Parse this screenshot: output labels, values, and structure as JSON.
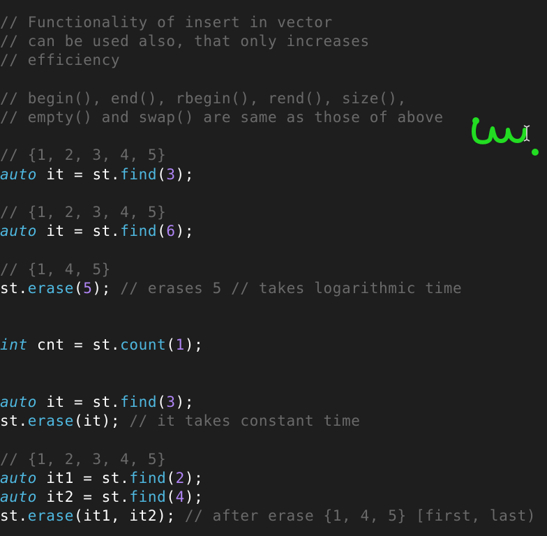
{
  "colors": {
    "background": "#1e1e1e",
    "comment": "#6a6a6a",
    "keyword": "#4fb8e0",
    "function": "#4fb8e0",
    "number": "#b085f5",
    "plain": "#ffffff",
    "annotation": "#22dd22"
  },
  "lines": [
    [
      {
        "t": "cm",
        "v": "// Functionality of insert in vector"
      }
    ],
    [
      {
        "t": "cm",
        "v": "// can be used also, that only increases"
      }
    ],
    [
      {
        "t": "cm",
        "v": "// efficiency"
      }
    ],
    [],
    [
      {
        "t": "cm",
        "v": "// begin(), end(), rbegin(), rend(), size(),"
      }
    ],
    [
      {
        "t": "cm",
        "v": "// empty() and swap() are same as those of above"
      }
    ],
    [],
    [
      {
        "t": "cm",
        "v": "// {1, 2, 3, 4, 5}"
      }
    ],
    [
      {
        "t": "kw",
        "v": "auto"
      },
      {
        "t": "pl",
        "v": " it = st."
      },
      {
        "t": "fn",
        "v": "find"
      },
      {
        "t": "pl",
        "v": "("
      },
      {
        "t": "num",
        "v": "3"
      },
      {
        "t": "pl",
        "v": ");"
      }
    ],
    [],
    [
      {
        "t": "cm",
        "v": "// {1, 2, 3, 4, 5}"
      }
    ],
    [
      {
        "t": "kw",
        "v": "auto"
      },
      {
        "t": "pl",
        "v": " it = st."
      },
      {
        "t": "fn",
        "v": "find"
      },
      {
        "t": "pl",
        "v": "("
      },
      {
        "t": "num",
        "v": "6"
      },
      {
        "t": "pl",
        "v": ");"
      }
    ],
    [],
    [
      {
        "t": "cm",
        "v": "// {1, 4, 5}"
      }
    ],
    [
      {
        "t": "pl",
        "v": "st."
      },
      {
        "t": "fn",
        "v": "erase"
      },
      {
        "t": "pl",
        "v": "("
      },
      {
        "t": "num",
        "v": "5"
      },
      {
        "t": "pl",
        "v": "); "
      },
      {
        "t": "cm",
        "v": "// erases 5 // takes logarithmic time"
      }
    ],
    [],
    [],
    [
      {
        "t": "kw",
        "v": "int"
      },
      {
        "t": "pl",
        "v": " cnt = st."
      },
      {
        "t": "fn",
        "v": "count"
      },
      {
        "t": "pl",
        "v": "("
      },
      {
        "t": "num",
        "v": "1"
      },
      {
        "t": "pl",
        "v": ");"
      }
    ],
    [],
    [],
    [
      {
        "t": "kw",
        "v": "auto"
      },
      {
        "t": "pl",
        "v": " it = st."
      },
      {
        "t": "fn",
        "v": "find"
      },
      {
        "t": "pl",
        "v": "("
      },
      {
        "t": "num",
        "v": "3"
      },
      {
        "t": "pl",
        "v": ");"
      }
    ],
    [
      {
        "t": "pl",
        "v": "st."
      },
      {
        "t": "fn",
        "v": "erase"
      },
      {
        "t": "pl",
        "v": "(it); "
      },
      {
        "t": "cm",
        "v": "// it takes constant time"
      }
    ],
    [],
    [
      {
        "t": "cm",
        "v": "// {1, 2, 3, 4, 5}"
      }
    ],
    [
      {
        "t": "kw",
        "v": "auto"
      },
      {
        "t": "pl",
        "v": " it1 = st."
      },
      {
        "t": "fn",
        "v": "find"
      },
      {
        "t": "pl",
        "v": "("
      },
      {
        "t": "num",
        "v": "2"
      },
      {
        "t": "pl",
        "v": ");"
      }
    ],
    [
      {
        "t": "kw",
        "v": "auto"
      },
      {
        "t": "pl",
        "v": " it2 = st."
      },
      {
        "t": "fn",
        "v": "find"
      },
      {
        "t": "pl",
        "v": "("
      },
      {
        "t": "num",
        "v": "4"
      },
      {
        "t": "pl",
        "v": ");"
      }
    ],
    [
      {
        "t": "pl",
        "v": "st."
      },
      {
        "t": "fn",
        "v": "erase"
      },
      {
        "t": "pl",
        "v": "(it1, it2); "
      },
      {
        "t": "cm",
        "v": "// after erase {1, 4, 5} [first, last)"
      }
    ]
  ],
  "annotation": {
    "icon": "handwritten-scribble-icon"
  },
  "cursor": {
    "icon": "text-cursor-icon"
  }
}
